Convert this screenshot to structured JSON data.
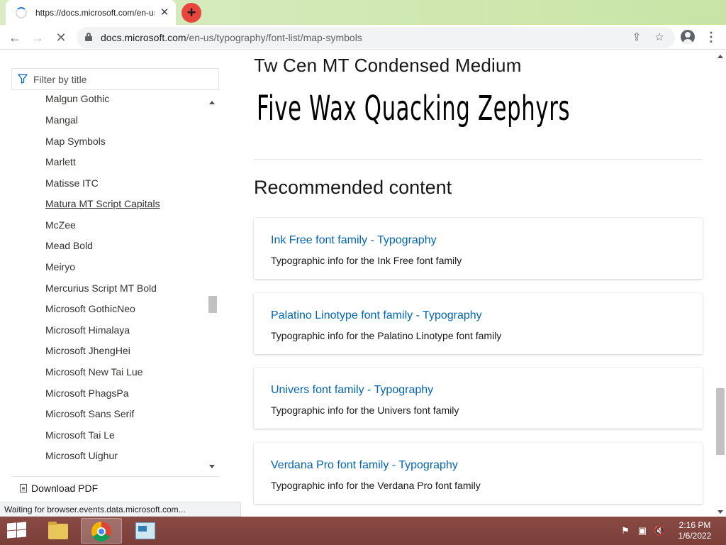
{
  "browser": {
    "tab_title": "https://docs.microsoft.com/en-us/",
    "url_domain": "docs.microsoft.com",
    "url_path": "/en-us/typography/font-list/map-symbols"
  },
  "sidebar": {
    "filter_placeholder": "Filter by title",
    "items": [
      "Malgun Gothic",
      "Mangal",
      "Map Symbols",
      "Marlett",
      "Matisse ITC",
      "Matura MT Script Capitals",
      "McZee",
      "Mead Bold",
      "Meiryo",
      "Mercurius Script MT Bold",
      "Microsoft GothicNeo",
      "Microsoft Himalaya",
      "Microsoft JhengHei",
      "Microsoft New Tai Lue",
      "Microsoft PhagsPa",
      "Microsoft Sans Serif",
      "Microsoft Tai Le",
      "Microsoft Uighur"
    ],
    "download_label": "Download PDF"
  },
  "main": {
    "font_name": "Tw Cen MT Condensed Medium",
    "sample_text": "Five Wax Quacking Zephyrs",
    "recommended_heading": "Recommended content",
    "cards": [
      {
        "title": "Ink Free font family - Typography",
        "description": "Typographic info for the Ink Free font family"
      },
      {
        "title": "Palatino Linotype font family - Typography",
        "description": "Typographic info for the Palatino Linotype font family"
      },
      {
        "title": "Univers font family - Typography",
        "description": "Typographic info for the Univers font family"
      },
      {
        "title": "Verdana Pro font family - Typography",
        "description": "Typographic info for the Verdana Pro font family"
      }
    ]
  },
  "status_text": "Waiting for browser.events.data.microsoft.com...",
  "taskbar": {
    "time": "2:16 PM",
    "date": "1/6/2022"
  },
  "colors": {
    "link": "#0065b3",
    "taskbar": "#7a3e39",
    "newtab_button": "#e8453c"
  },
  "icons": [
    "loading-spinner-icon",
    "close-icon",
    "plus-icon",
    "back-arrow-icon",
    "forward-arrow-icon",
    "stop-icon",
    "lock-icon",
    "share-icon",
    "star-icon",
    "profile-icon",
    "more-icon",
    "filter-icon",
    "document-icon",
    "windows-logo-icon",
    "folder-icon",
    "chrome-icon",
    "flag-icon",
    "network-icon",
    "volume-muted-icon"
  ]
}
